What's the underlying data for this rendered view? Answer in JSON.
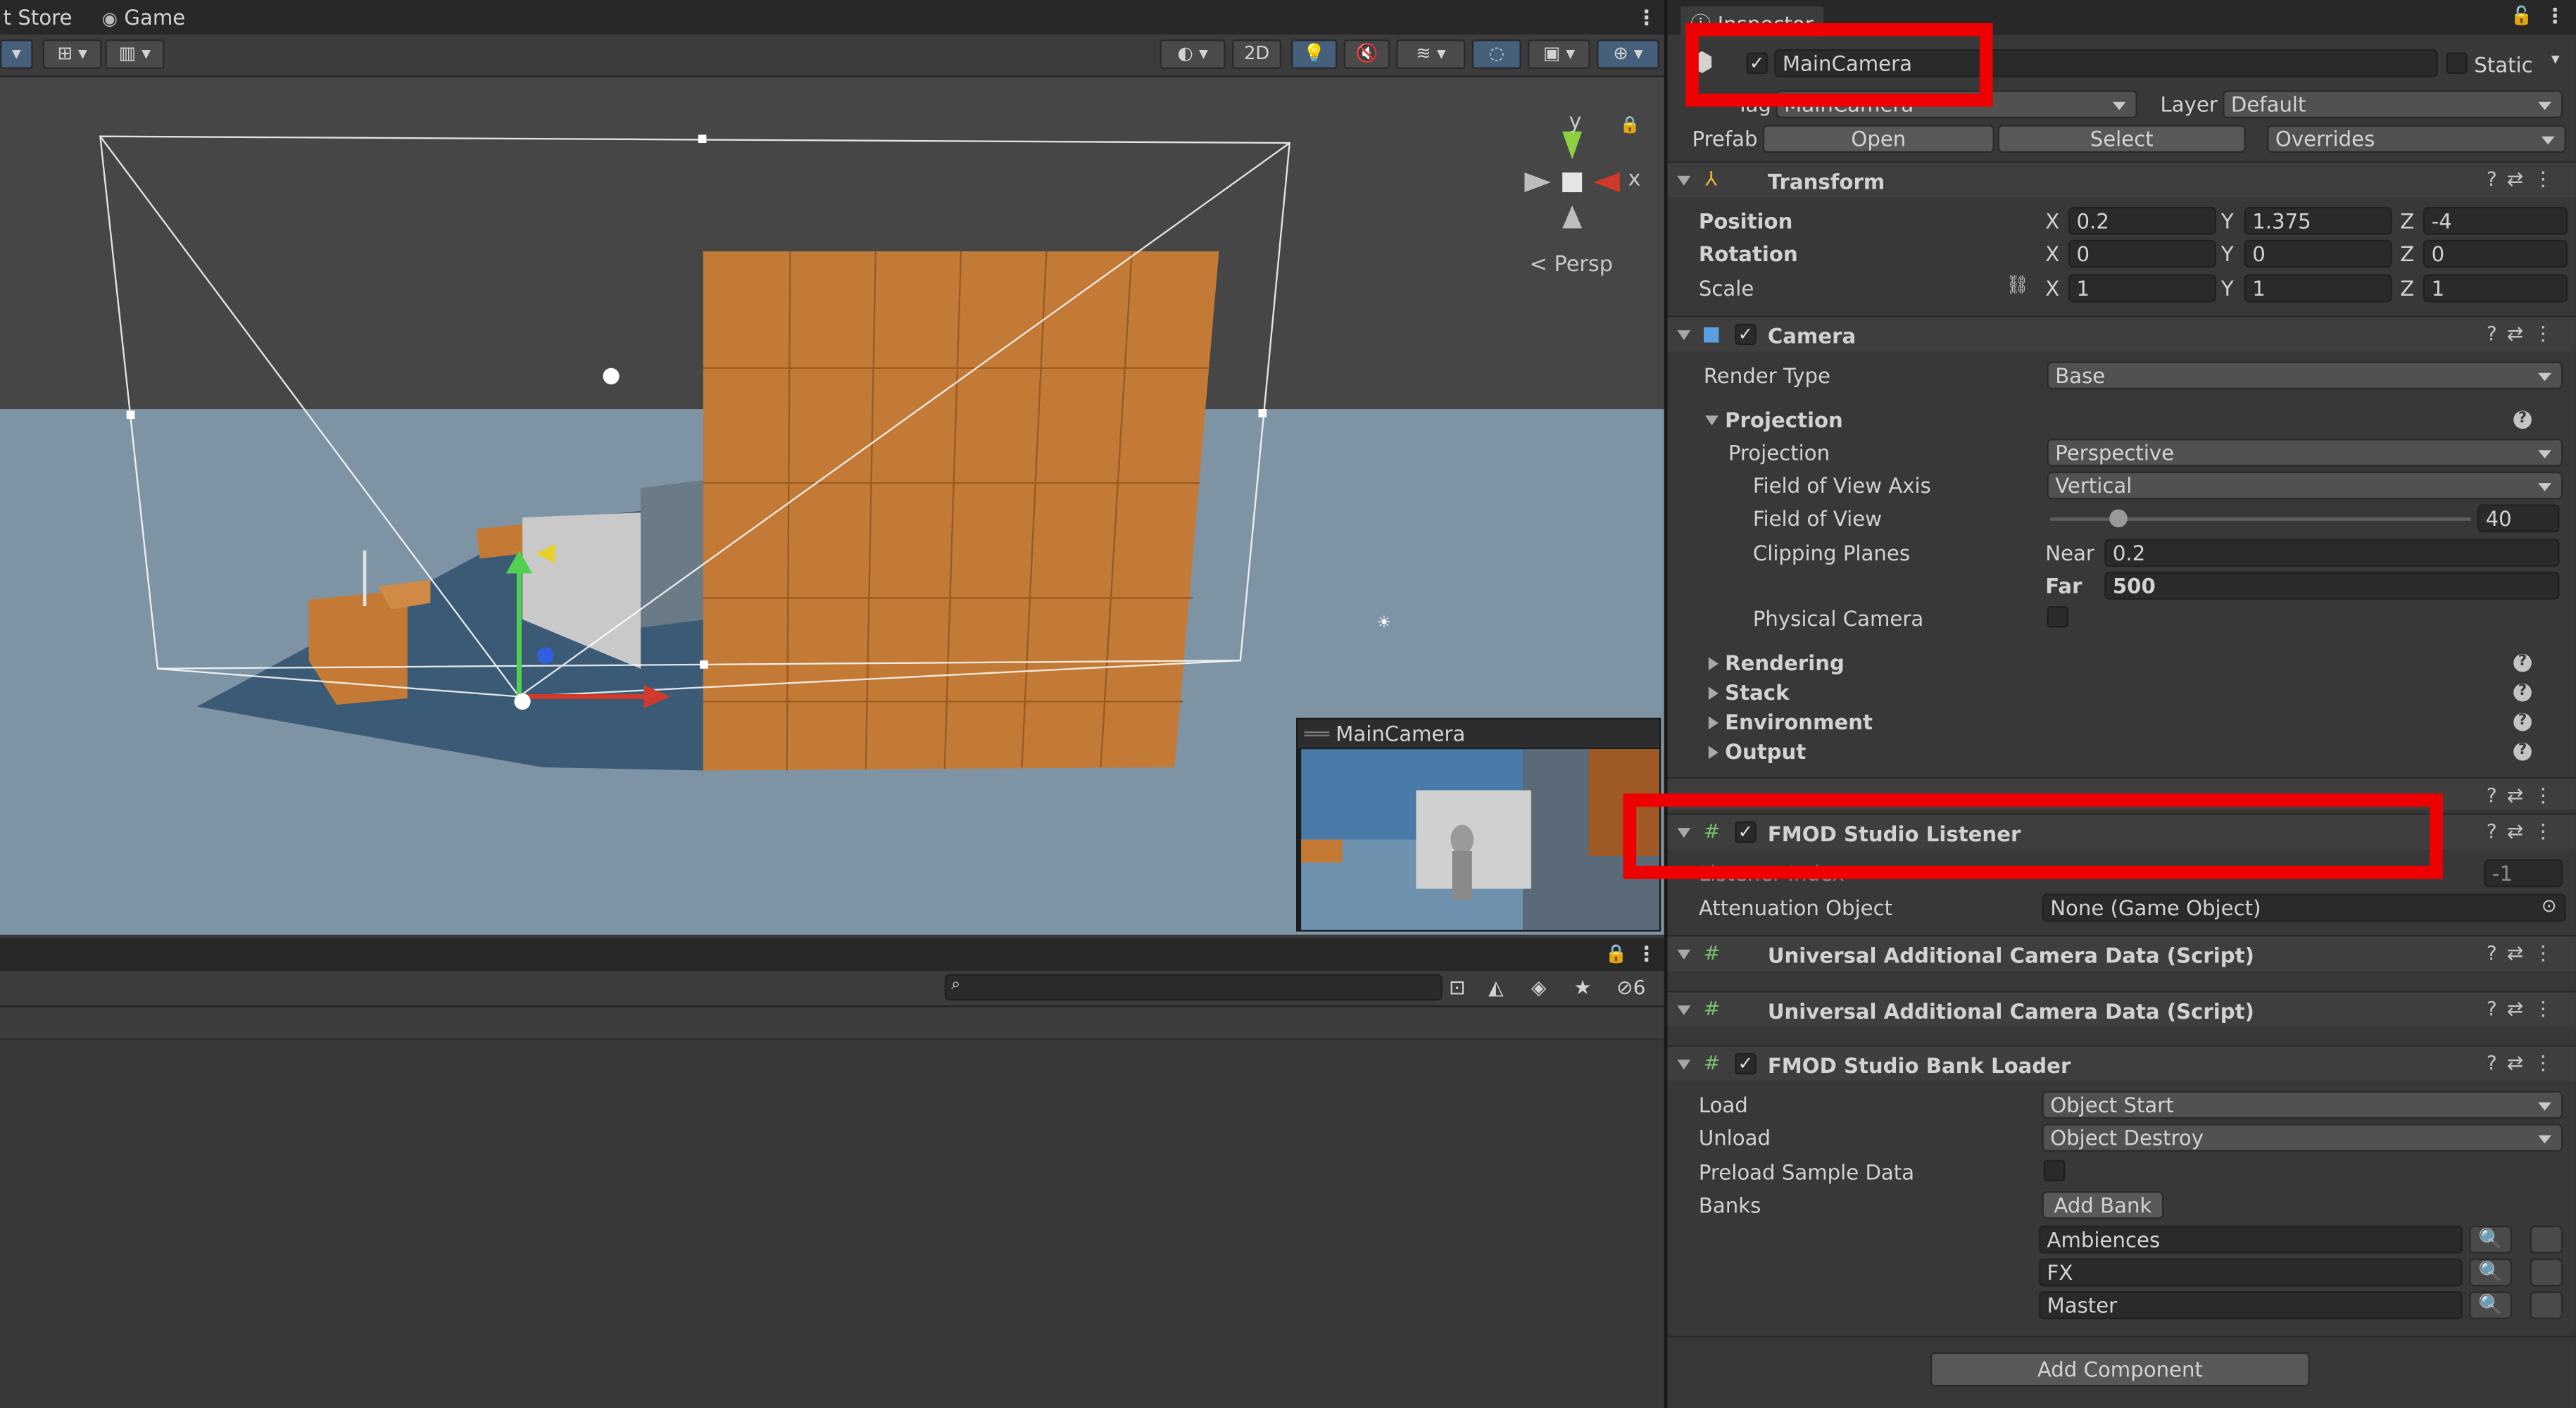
{
  "tabs": {
    "asset_store": "t Store",
    "game": "Game"
  },
  "scene": {
    "toolbar_2d": "2D",
    "persp_label": "< Persp",
    "axis_y": "y",
    "axis_x": "x",
    "preview_title": "MainCamera"
  },
  "console": {
    "hidden_count": "6",
    "search_placeholder": ""
  },
  "inspector": {
    "tab_title": "Inspector",
    "object_name": "MainCamera",
    "static_label": "Static",
    "tag_label": "Tag",
    "tag_value": "MainCamera",
    "layer_label": "Layer",
    "layer_value": "Default",
    "prefab_label": "Prefab",
    "prefab_open": "Open",
    "prefab_select": "Select",
    "prefab_overrides": "Overrides",
    "transform": {
      "title": "Transform",
      "position_label": "Position",
      "rotation_label": "Rotation",
      "scale_label": "Scale",
      "x": "X",
      "y": "Y",
      "z": "Z",
      "position": {
        "x": "0.2",
        "y": "1.375",
        "z": "-4"
      },
      "rotation": {
        "x": "0",
        "y": "0",
        "z": "0"
      },
      "scale": {
        "x": "1",
        "y": "1",
        "z": "1"
      }
    },
    "camera": {
      "title": "Camera",
      "render_type_label": "Render Type",
      "render_type_value": "Base",
      "projection_section": "Projection",
      "projection_label": "Projection",
      "projection_value": "Perspective",
      "fov_axis_label": "Field of View Axis",
      "fov_axis_value": "Vertical",
      "fov_label": "Field of View",
      "fov_value": "40",
      "fov_fraction": 0.16,
      "clipping_label": "Clipping Planes",
      "near_label": "Near",
      "near_value": "0.2",
      "far_label": "Far",
      "far_value": "500",
      "physical_label": "Physical Camera",
      "rendering": "Rendering",
      "stack": "Stack",
      "environment": "Environment",
      "output": "Output"
    },
    "listener": {
      "title": "FMOD Studio Listener",
      "listener_index_label": "Listener Index",
      "listener_index_value": "-1",
      "attenuation_label": "Attenuation Object",
      "attenuation_value": "None (Game Object)"
    },
    "ucd1_title": "Universal Additional Camera Data (Script)",
    "ucd2_title": "Universal Additional Camera Data (Script)",
    "bank_loader": {
      "title": "FMOD Studio Bank Loader",
      "load_label": "Load",
      "load_value": "Object Start",
      "unload_label": "Unload",
      "unload_value": "Object Destroy",
      "preload_label": "Preload Sample Data",
      "banks_label": "Banks",
      "add_bank": "Add Bank",
      "banks": [
        "Ambiences",
        "FX",
        "Master"
      ]
    },
    "add_component": "Add Component"
  },
  "colors": {
    "highlight": "#ee0000",
    "accent": "#46607c",
    "panel": "#383838"
  }
}
